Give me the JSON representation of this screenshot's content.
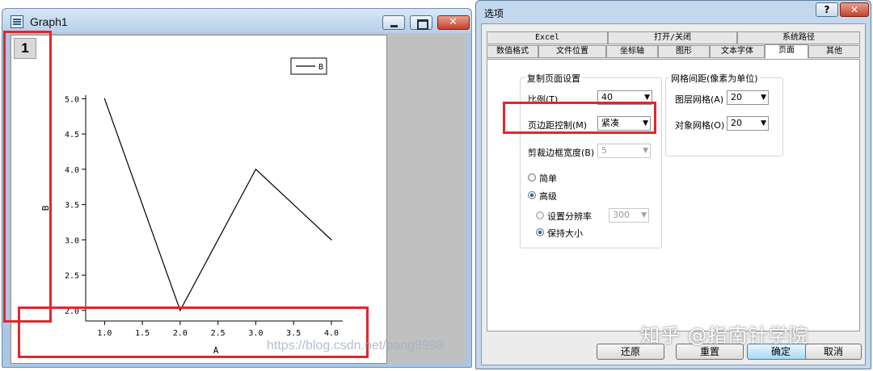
{
  "graph_window": {
    "title": "Graph1",
    "layer_number": "1"
  },
  "chart_data": {
    "type": "line",
    "x": [
      1.0,
      2.0,
      3.0,
      4.0
    ],
    "series": [
      {
        "name": "B",
        "values": [
          5.0,
          2.0,
          4.0,
          3.0
        ],
        "color": "#000000"
      }
    ],
    "xlabel": "A",
    "ylabel": "B",
    "xlim": [
      0.75,
      4.15
    ],
    "ylim": [
      1.85,
      5.05
    ],
    "xticks": [
      "1.0",
      "1.5",
      "2.0",
      "2.5",
      "3.0",
      "3.5",
      "4.0"
    ],
    "yticks": [
      "2.0",
      "2.5",
      "3.0",
      "3.5",
      "4.0",
      "4.5",
      "5.0"
    ],
    "legend": "top-right",
    "grid": false
  },
  "annotation_color": "#e0272b",
  "watermark_left": "https://blog.csdn.net/pang9998",
  "dialog": {
    "title": "选项",
    "help_label": "?",
    "close_label": "✕",
    "tabs_row1": [
      "Excel",
      "打开/关闭",
      "系统路径"
    ],
    "tabs_row2": [
      "数值格式",
      "文件位置",
      "坐标轴",
      "图形",
      "文本字体",
      "页面",
      "其他"
    ],
    "active_tab": "页面",
    "copy_page_group": {
      "title": "复制页面设置",
      "scale_label": "比例(T)",
      "scale_value": "40",
      "margin_label": "页边距控制(M)",
      "margin_value": "紧凑",
      "crop_label": "剪裁边框宽度(B)",
      "crop_value": "5",
      "radio_simple": "简单",
      "radio_advanced": "高级",
      "radio_dpi": "设置分辨率",
      "dpi_value": "300",
      "radio_keep_size": "保持大小"
    },
    "grid_group": {
      "title": "网格间距(像素为单位)",
      "layer_grid_label": "图层网格(A)",
      "layer_grid_value": "20",
      "object_grid_label": "对象网格(O)",
      "object_grid_value": "20"
    },
    "buttons": {
      "restore": "还原",
      "reset": "重置",
      "ok": "确定",
      "cancel": "取消"
    }
  },
  "watermark_zhihu": "知乎 @指南针学院"
}
